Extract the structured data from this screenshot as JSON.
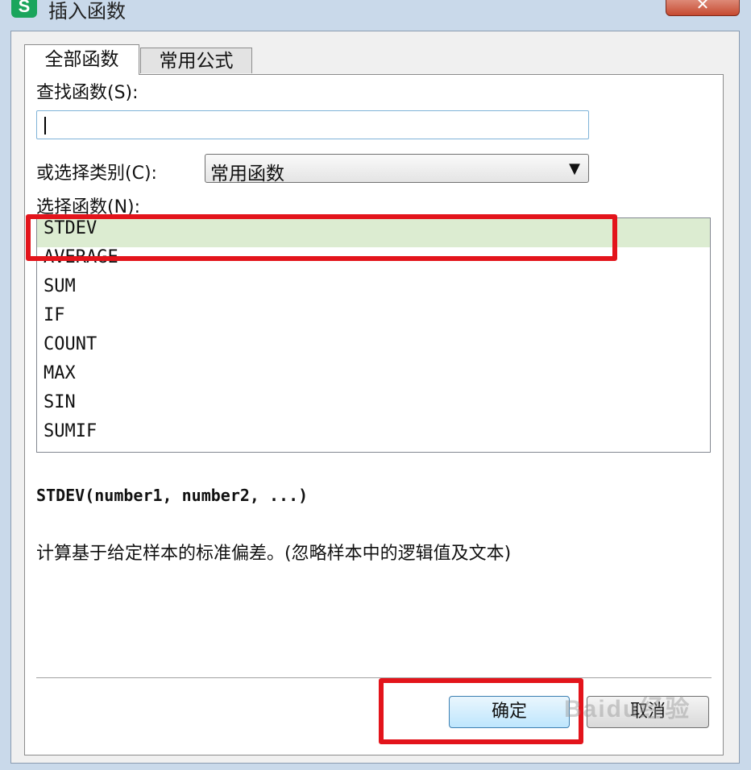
{
  "window": {
    "title": "插入函数",
    "app_icon_letter": "S",
    "close_glyph": "✕"
  },
  "tabs": [
    {
      "label": "全部函数",
      "active": true
    },
    {
      "label": "常用公式",
      "active": false
    }
  ],
  "search": {
    "label": "查找函数(S):",
    "value": ""
  },
  "category": {
    "label": "或选择类别(C):",
    "selected": "常用函数"
  },
  "function_list": {
    "label": "选择函数(N):",
    "items": [
      "STDEV",
      "AVERAGE",
      "SUM",
      "IF",
      "COUNT",
      "MAX",
      "SIN",
      "SUMIF"
    ],
    "selected": "STDEV"
  },
  "details": {
    "signature": "STDEV(number1, number2, ...)",
    "description": "计算基于给定样本的标准偏差。(忽略样本中的逻辑值及文本)"
  },
  "buttons": {
    "ok": "确定",
    "cancel": "取消"
  },
  "watermark": "Baidu经验",
  "colors": {
    "selection": "#dcecd1",
    "annotation_red": "#e3141b",
    "app_icon": "#1aa55c"
  }
}
